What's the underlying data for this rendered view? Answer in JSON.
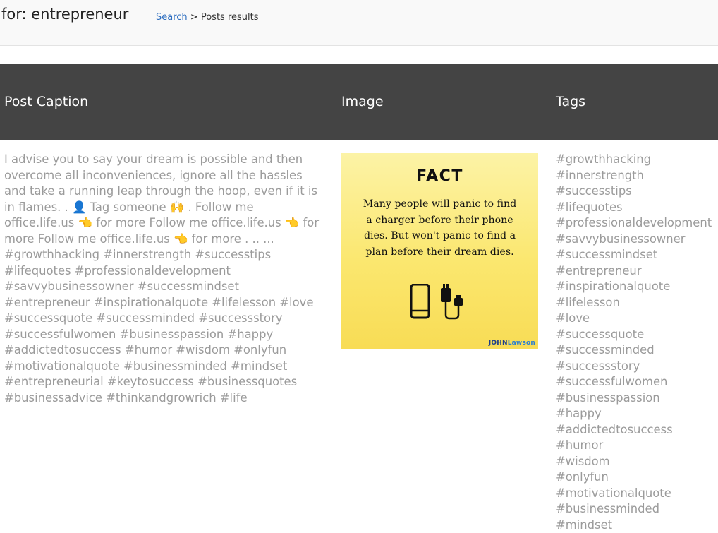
{
  "header": {
    "title": "for: entrepreneur",
    "breadcrumb_link": "Search",
    "breadcrumb_separator": " > ",
    "breadcrumb_current": "Posts results"
  },
  "table": {
    "columns": [
      "Post Caption",
      "Image",
      "Tags"
    ]
  },
  "post": {
    "caption": "I advise you to say your dream is possible and then overcome all inconveniences, ignore all the hassles and take a running leap through the hoop, even if it is in flames. . 👤 Tag someone 🙌 . Follow me office.life.us 👈 for more Follow me office.life.us 👈 for more Follow me office.life.us 👈 for more . .. ... #growthhacking #innerstrength #successtips #lifequotes #professionaldevelopment #savvybusinessowner #successmindset #entrepreneur #inspirationalquote #lifelesson #love #successquote #successminded #successstory #successfulwomen #businesspassion #happy #addictedtosuccess #humor #wisdom #onlyfun #motivationalquote #businessminded #mindset #entrepreneurial #keytosuccess #businessquotes #businessadvice #thinkandgrowrich #life",
    "image": {
      "heading": "FACT",
      "text": "Many people will panic to find a charger before their phone dies. But won't panic to find a plan before their dream dies.",
      "logo_main": "JOHN",
      "logo_accent": "Lawson",
      "icons": [
        "phone-icon",
        "charger-icon"
      ]
    },
    "tags": [
      "#growthhacking",
      "#innerstrength",
      "#successtips",
      "#lifequotes",
      "#professionaldevelopment",
      "#savvybusinessowner",
      "#successmindset",
      "#entrepreneur",
      "#inspirationalquote",
      "#lifelesson",
      "#love",
      "#successquote",
      "#successminded",
      "#successstory",
      "#successfulwomen",
      "#businesspassion",
      "#happy",
      "#addictedtosuccess",
      "#humor",
      "#wisdom",
      "#onlyfun",
      "#motivationalquote",
      "#businessminded",
      "#mindset"
    ]
  },
  "colors": {
    "header_bg": "#444444",
    "link": "#2f6fc0",
    "muted_text": "#9b9b9b",
    "image_bg": "#fbe76f"
  }
}
